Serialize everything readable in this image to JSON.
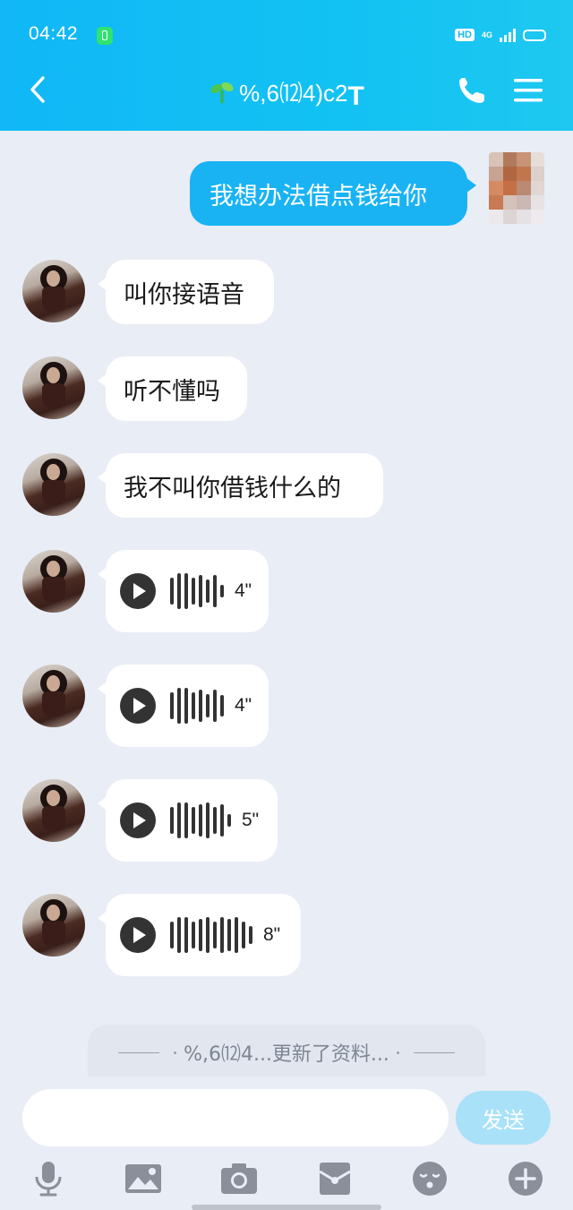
{
  "status_bar": {
    "time": "04:42",
    "hd_label": "HD",
    "network": "4G"
  },
  "header": {
    "title": "%,6⑿4)c2",
    "title_suffix": "T",
    "accent_color": "#13bdf4"
  },
  "messages": [
    {
      "side": "out",
      "type": "text",
      "text": "我想办法借点钱给你"
    },
    {
      "side": "in",
      "type": "text",
      "text": "叫你接语音"
    },
    {
      "side": "in",
      "type": "text",
      "text": "听不懂吗"
    },
    {
      "side": "in",
      "type": "text",
      "text": "我不叫你借钱什么的"
    },
    {
      "side": "in",
      "type": "voice",
      "duration": "4\""
    },
    {
      "side": "in",
      "type": "voice",
      "duration": "4\""
    },
    {
      "side": "in",
      "type": "voice",
      "duration": "5\""
    },
    {
      "side": "in",
      "type": "voice",
      "duration": "8\""
    }
  ],
  "notice": {
    "text": "%,6⑿4...更新了资料..."
  },
  "composer": {
    "input_value": "",
    "send_label": "发送"
  },
  "toolbar": [
    "microphone-icon",
    "image-icon",
    "camera-icon",
    "red-packet-icon",
    "emoji-icon",
    "plus-icon"
  ]
}
